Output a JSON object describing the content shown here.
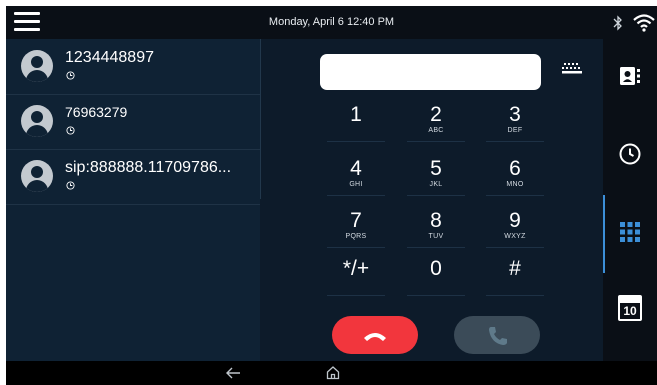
{
  "status_bar": {
    "datetime": "Monday, April 6 12:40 PM"
  },
  "recents": [
    {
      "name": "1234448897",
      "icon": "clock-icon"
    },
    {
      "name": "76963279",
      "icon": "clock-icon"
    },
    {
      "name": "sip:888888.11709786...",
      "icon": "clock-icon"
    }
  ],
  "dialpad": {
    "number_value": "",
    "keys": [
      {
        "digit": "1",
        "letters": ""
      },
      {
        "digit": "2",
        "letters": "ABC"
      },
      {
        "digit": "3",
        "letters": "DEF"
      },
      {
        "digit": "4",
        "letters": "GHI"
      },
      {
        "digit": "5",
        "letters": "JKL"
      },
      {
        "digit": "6",
        "letters": "MNO"
      },
      {
        "digit": "7",
        "letters": "PQRS"
      },
      {
        "digit": "8",
        "letters": "TUV"
      },
      {
        "digit": "9",
        "letters": "WXYZ"
      },
      {
        "digit": "*/+",
        "letters": ""
      },
      {
        "digit": "0",
        "letters": ""
      },
      {
        "digit": "#",
        "letters": ""
      }
    ]
  },
  "side_nav": {
    "items": [
      {
        "icon": "contacts-icon",
        "active": false
      },
      {
        "icon": "recents-clock-icon",
        "active": false
      },
      {
        "icon": "dialpad-icon",
        "active": true
      },
      {
        "icon": "calendar-icon",
        "date": "10",
        "active": false
      }
    ]
  },
  "colors": {
    "background": "#0d1b2a",
    "recents_panel": "#0f2234",
    "end_call": "#f2363d",
    "dial_call_disabled": "#3b4b58",
    "accent": "#3c8fd8"
  }
}
